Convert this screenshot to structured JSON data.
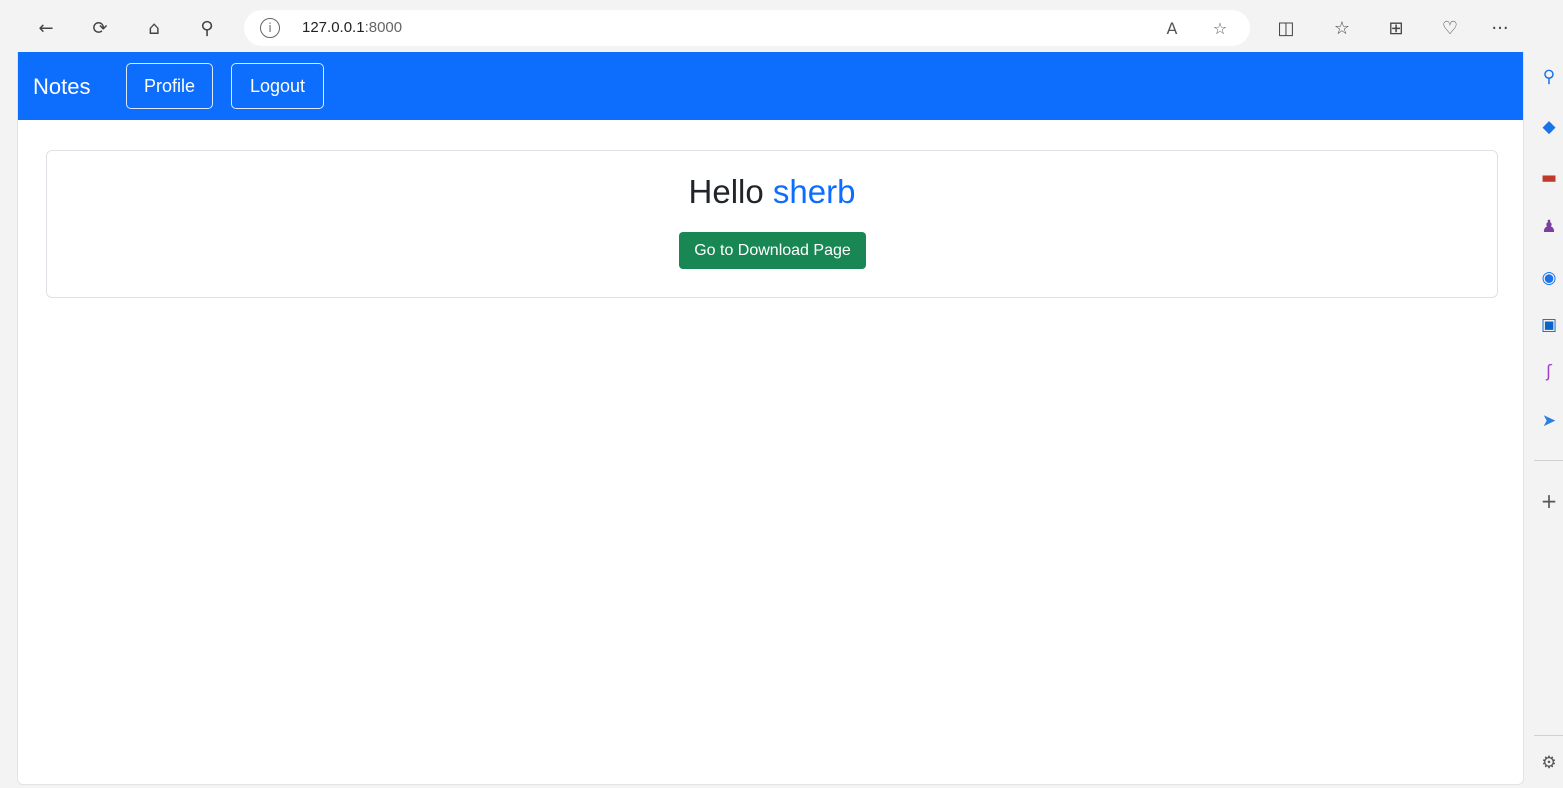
{
  "browser": {
    "address": {
      "host": "127.0.0.1",
      "port": ":8000"
    },
    "icons": {
      "back": "←",
      "refresh": "⟳",
      "home": "⌂",
      "search": "⚲",
      "info": "i",
      "read_aloud": "A",
      "favorite": "☆",
      "split": "◫",
      "favorites": "☆",
      "collections": "⊞",
      "health": "♡",
      "more": "···",
      "copilot": "◆"
    }
  },
  "sidebar": {
    "icons": {
      "search": "⚲",
      "tag": "◆",
      "tools": "▬",
      "people": "♟",
      "office": "◉",
      "outlook": "▣",
      "designer": "ʃ",
      "send": "➤",
      "add": "+",
      "settings": "⚙"
    }
  },
  "page": {
    "navbar": {
      "brand": "Notes",
      "profile_label": "Profile",
      "logout_label": "Logout"
    },
    "card": {
      "greeting": "Hello",
      "username": "sherb",
      "download_label": "Go to Download Page"
    }
  },
  "colors": {
    "navbar": "#0d6efd",
    "username": "#0d6efd",
    "download_button": "#198754"
  }
}
